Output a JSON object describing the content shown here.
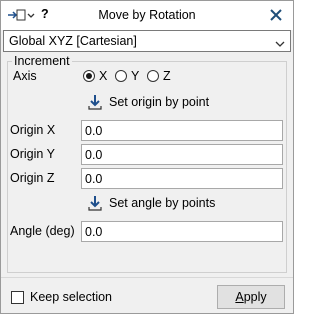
{
  "window": {
    "title": "Move by Rotation",
    "help_label": "?",
    "close_icon": "close-icon"
  },
  "coordinate_system": {
    "selected": "Global XYZ [Cartesian]"
  },
  "increment": {
    "legend": "Increment",
    "axis_label": "Axis",
    "axis_options": [
      {
        "label": "X",
        "checked": true
      },
      {
        "label": "Y",
        "checked": false
      },
      {
        "label": "Z",
        "checked": false
      }
    ],
    "set_origin_label": "Set origin by point",
    "origin_x_label": "Origin X",
    "origin_x_value": "0.0",
    "origin_y_label": "Origin Y",
    "origin_y_value": "0.0",
    "origin_z_label": "Origin Z",
    "origin_z_value": "0.0",
    "set_angle_label": "Set angle by points",
    "angle_label": "Angle (deg)",
    "angle_value": "0.0"
  },
  "footer": {
    "keep_selection_label": "Keep selection",
    "keep_selection_checked": false,
    "apply_underlined": "A",
    "apply_rest": "pply"
  },
  "colors": {
    "dialog_bg": "#f0f0f0",
    "accent_blue": "#1e4f8c",
    "close_x": "#1f4e79"
  }
}
